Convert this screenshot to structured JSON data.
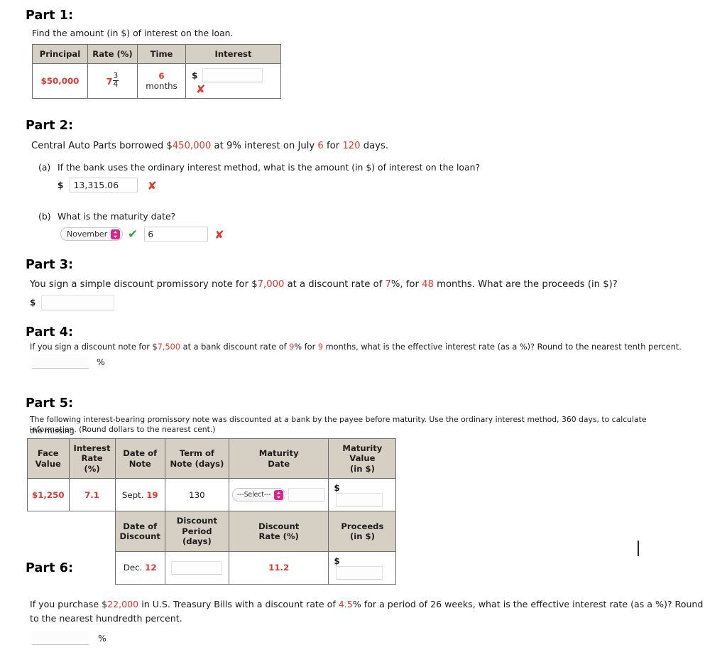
{
  "parts": {
    "part1": {
      "title": "Part 1:",
      "prompt": "Find the amount (in $) of interest on the loan.",
      "table": {
        "headers": [
          "Principal",
          "Rate (%)",
          "Time",
          "Interest"
        ],
        "row": {
          "principal": "$50,000",
          "rate_whole": "7",
          "rate_num": "3",
          "rate_den": "4",
          "time_value": "6",
          "time_unit": "months",
          "interest_dollar": "$",
          "interest_value": "",
          "interest_placeholder": "",
          "interest_mark": "✘"
        }
      }
    },
    "part2": {
      "title": "Part 2:",
      "prompt_a": "Central Auto Parts borrowed $",
      "prompt_amount": "450,000",
      "prompt_b": " at 9% interest on July ",
      "prompt_day": "6",
      "prompt_c": " for ",
      "prompt_days": "120",
      "prompt_d": " days.",
      "a_label": "(a)",
      "a_text": "If the bank uses the ordinary interest method, what is the amount (in $) of interest on the loan?",
      "a_dollar": "$",
      "a_value": "13,315.06",
      "a_mark": "✘",
      "b_label": "(b)",
      "b_text": "What is the maturity date?",
      "b_month": "November",
      "b_month_check": "✔",
      "b_day": "6",
      "b_day_mark": "✘"
    },
    "part3": {
      "title": "Part 3:",
      "prompt_a": "You sign a simple discount promissory note for $",
      "prompt_amount": "7,000",
      "prompt_b": " at a discount rate of ",
      "prompt_rate": "7",
      "prompt_c": "%, for ",
      "prompt_months": "48",
      "prompt_d": " months. What are the proceeds (in $)?",
      "dollar": "$",
      "answer_value": ""
    },
    "part4": {
      "title": "Part 4:",
      "prompt_a": "If you sign a discount note for $",
      "prompt_amount": "7,500",
      "prompt_b": " at a bank discount rate of ",
      "prompt_rate": "9",
      "prompt_c": "% for ",
      "prompt_months": "9",
      "prompt_d": " months, what is the effective interest rate (as a %)? Round to the nearest tenth percent.",
      "answer_value": "",
      "percent": "%"
    },
    "part5": {
      "title": "Part 5:",
      "prompt_line1": "The following interest-bearing promissory note was discounted at a bank by the payee before maturity. Use the ordinary interest method, 360 days, to calculate the missing",
      "prompt_line2": "information. (Round dollars to the nearest cent.)",
      "headers_row1": [
        "Face\nValue",
        "Interest\nRate (%)",
        "Date of\nNote",
        "Term of\nNote (days)",
        "Maturity\nDate",
        "Maturity\nValue\n(in $)"
      ],
      "headers_row1_lines": [
        [
          "Face",
          "Value"
        ],
        [
          "Interest",
          "Rate (%)"
        ],
        [
          "Date of",
          "Note"
        ],
        [
          "Term of",
          "Note (days)"
        ],
        [
          "Maturity",
          "Date"
        ],
        [
          "Maturity",
          "Value",
          "(in $)"
        ]
      ],
      "row1": {
        "face_value": "$1,250",
        "interest_rate": "7.1",
        "date_of_note_month": "Sept.",
        "date_of_note_day": "19",
        "term_of_note": "130",
        "maturity_select_label": "---Select---",
        "maturity_day_value": "",
        "maturity_value_dollar": "$",
        "maturity_value": ""
      },
      "headers_row2_lines": [
        [
          "Date of",
          "Discount"
        ],
        [
          "Discount",
          "Period (days)"
        ],
        [
          "Discount",
          "Rate (%)"
        ],
        [
          "Proceeds",
          "(in $)"
        ]
      ],
      "row2": {
        "date_of_discount_month": "Dec.",
        "date_of_discount_day": "12",
        "discount_period_value": "",
        "discount_rate": "11.2",
        "proceeds_dollar": "$",
        "proceeds_value": ""
      }
    },
    "part6": {
      "title": "Part 6:",
      "prompt_a": "If you purchase $",
      "prompt_amount": "22,000",
      "prompt_b": " in U.S. Treasury Bills with a discount rate of ",
      "prompt_rate": "4.5",
      "prompt_c": "% for a period of 26 weeks, what is the effective interest rate (as a %)? Round to the nearest",
      "prompt_d": "hundredth percent.",
      "answer_value": "",
      "percent": "%"
    }
  },
  "colors": {
    "red": "#e8352a",
    "green": "#3aa63a",
    "header_bg": "#d6d0c4",
    "magenta": "#e0218a"
  }
}
